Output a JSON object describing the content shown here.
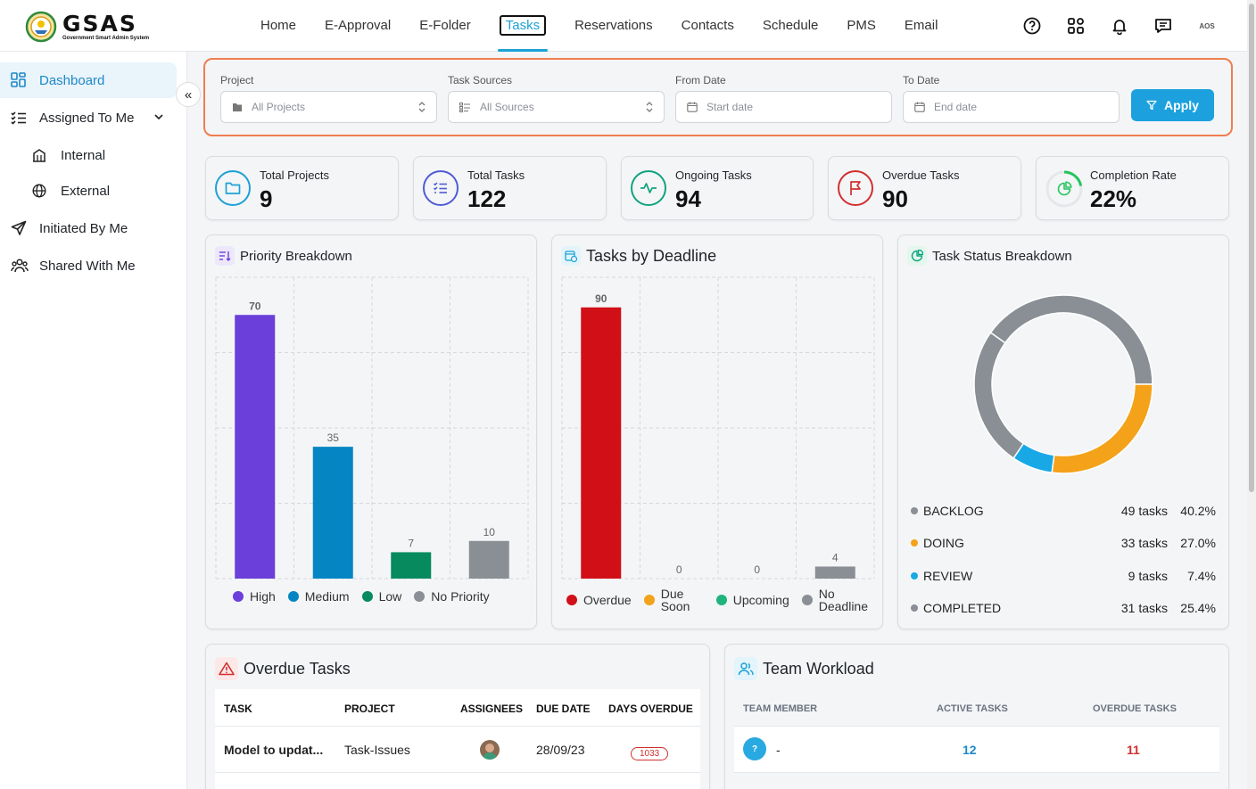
{
  "app": {
    "logo_title": "GSAS",
    "logo_subtitle": "Government Smart Admin System",
    "avatar_initials": "AOS"
  },
  "nav": {
    "items": [
      "Home",
      "E-Approval",
      "E-Folder",
      "Tasks",
      "Reservations",
      "Contacts",
      "Schedule",
      "PMS",
      "Email"
    ],
    "active": "Tasks"
  },
  "top_icons": [
    "help-icon",
    "apps-grid-icon",
    "bell-icon",
    "chat-icon"
  ],
  "sidebar": {
    "items": [
      {
        "label": "Dashboard",
        "icon": "dashboard-icon",
        "active": true
      },
      {
        "label": "Assigned To Me",
        "icon": "checklist-icon",
        "expanded": true
      },
      {
        "label": "Internal",
        "icon": "building-icon"
      },
      {
        "label": "External",
        "icon": "globe-icon"
      },
      {
        "label": "Initiated By Me",
        "icon": "send-icon"
      },
      {
        "label": "Shared With Me",
        "icon": "users-icon"
      }
    ]
  },
  "filters": {
    "project": {
      "label": "Project",
      "placeholder": "All Projects"
    },
    "sources": {
      "label": "Task Sources",
      "placeholder": "All Sources"
    },
    "from": {
      "label": "From Date",
      "placeholder": "Start date"
    },
    "to": {
      "label": "To Date",
      "placeholder": "End date"
    },
    "apply_label": "Apply"
  },
  "stats": [
    {
      "label": "Total Projects",
      "value": "9",
      "color": "#1da1d6",
      "icon": "folder-icon"
    },
    {
      "label": "Total Tasks",
      "value": "122",
      "color": "#4f5bd5",
      "icon": "list-icon"
    },
    {
      "label": "Ongoing Tasks",
      "value": "94",
      "color": "#10a37f",
      "icon": "activity-icon"
    },
    {
      "label": "Overdue Tasks",
      "value": "90",
      "color": "#d32f2f",
      "icon": "flag-icon"
    },
    {
      "label": "Completion Rate",
      "value": "22%",
      "color": "#22c55e",
      "icon": "pie-icon",
      "progress": 0.22
    }
  ],
  "priority": {
    "title": "Priority Breakdown"
  },
  "deadline": {
    "title": "Tasks by Deadline"
  },
  "status": {
    "title": "Task Status Breakdown"
  },
  "chart_data": [
    {
      "type": "bar",
      "title": "Priority Breakdown",
      "categories": [
        "High",
        "Medium",
        "Low",
        "No Priority"
      ],
      "values": [
        70,
        35,
        7,
        10
      ],
      "colors": [
        "#6b3fd9",
        "#0586c3",
        "#078a5e",
        "#8a8f96"
      ],
      "ylim": [
        0,
        80
      ],
      "grid": true,
      "legend": "bottom"
    },
    {
      "type": "bar",
      "title": "Tasks by Deadline",
      "categories": [
        "Overdue",
        "Due Soon",
        "Upcoming",
        "No Deadline"
      ],
      "values": [
        90,
        0,
        0,
        4
      ],
      "colors": [
        "#d10f17",
        "#f2a21b",
        "#1fb47d",
        "#8a8f96"
      ],
      "ylim": [
        0,
        100
      ],
      "grid": true,
      "legend": "bottom"
    },
    {
      "type": "pie",
      "title": "Task Status Breakdown",
      "categories": [
        "BACKLOG",
        "DOING",
        "REVIEW",
        "COMPLETED"
      ],
      "values": [
        49,
        33,
        9,
        31
      ],
      "percents": [
        "40.2%",
        "27.0%",
        "7.4%",
        "25.4%"
      ],
      "counts": [
        "49 tasks",
        "33 tasks",
        "9 tasks",
        "31 tasks"
      ],
      "colors": [
        "#8a8f96",
        "#f4a21a",
        "#19a8e6",
        "#8a8f96"
      ],
      "legend": "bottom"
    }
  ],
  "overdue": {
    "title": "Overdue Tasks",
    "headers": [
      "TASK",
      "PROJECT",
      "ASSIGNEES",
      "DUE DATE",
      "DAYS OVERDUE"
    ],
    "rows": [
      {
        "task": "Model to updat...",
        "project": "Task-Issues",
        "due": "28/09/23",
        "days": "1033"
      }
    ]
  },
  "workload": {
    "title": "Team Workload",
    "headers": [
      "TEAM MEMBER",
      "ACTIVE TASKS",
      "OVERDUE TASKS"
    ],
    "rows": [
      {
        "initial": "?",
        "member": "-",
        "active": "12",
        "overdue": "11"
      }
    ]
  }
}
